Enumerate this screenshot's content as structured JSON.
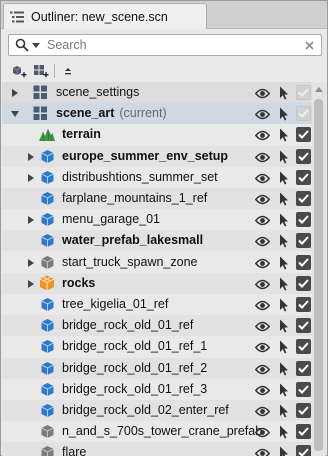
{
  "window": {
    "tab_title": "Outliner: new_scene.scn",
    "tab_icon": "outliner-list-icon"
  },
  "search": {
    "placeholder": "Search",
    "value": ""
  },
  "toolbar": {
    "buttons": [
      "add-object-icon",
      "add-layer-icon",
      "collapse-all-icon"
    ]
  },
  "rows": [
    {
      "label": "scene_settings",
      "suffix": "",
      "bold": false,
      "arrow": "right",
      "icon": "layer-grid-icon",
      "indent": 0,
      "visible": true,
      "enabled": false
    },
    {
      "label": "scene_art",
      "suffix": "(current)",
      "bold": true,
      "arrow": "down",
      "icon": "layer-grid-icon",
      "indent": 0,
      "visible": true,
      "enabled": false
    },
    {
      "label": "terrain",
      "suffix": "",
      "bold": true,
      "arrow": "",
      "icon": "terrain-icon",
      "indent": 1,
      "visible": true,
      "enabled": true
    },
    {
      "label": "europe_summer_env_setup",
      "suffix": "",
      "bold": true,
      "arrow": "right",
      "icon": "blue-cube-icon",
      "indent": 1,
      "visible": true,
      "enabled": true
    },
    {
      "label": "distribushtions_summer_set",
      "suffix": "",
      "bold": false,
      "arrow": "right",
      "icon": "blue-cube-icon",
      "indent": 1,
      "visible": true,
      "enabled": true
    },
    {
      "label": "farplane_mountains_1_ref",
      "suffix": "",
      "bold": false,
      "arrow": "",
      "icon": "blue-cube-icon",
      "indent": 1,
      "visible": true,
      "enabled": true
    },
    {
      "label": "menu_garage_01",
      "suffix": "",
      "bold": false,
      "arrow": "right",
      "icon": "blue-cube-icon",
      "indent": 1,
      "visible": true,
      "enabled": true
    },
    {
      "label": "water_prefab_lakesmall",
      "suffix": "",
      "bold": true,
      "arrow": "",
      "icon": "blue-cube-icon",
      "indent": 1,
      "visible": true,
      "enabled": true
    },
    {
      "label": "start_truck_spawn_zone",
      "suffix": "",
      "bold": false,
      "arrow": "right",
      "icon": "gray-cube-icon",
      "indent": 1,
      "visible": true,
      "enabled": true
    },
    {
      "label": "rocks",
      "suffix": "",
      "bold": true,
      "arrow": "right",
      "icon": "orange-group-icon",
      "indent": 1,
      "visible": true,
      "enabled": true
    },
    {
      "label": "tree_kigelia_01_ref",
      "suffix": "",
      "bold": false,
      "arrow": "",
      "icon": "blue-cube-icon",
      "indent": 1,
      "visible": true,
      "enabled": true
    },
    {
      "label": "bridge_rock_old_01_ref",
      "suffix": "",
      "bold": false,
      "arrow": "",
      "icon": "blue-cube-icon",
      "indent": 1,
      "visible": true,
      "enabled": true
    },
    {
      "label": "bridge_rock_old_01_ref_1",
      "suffix": "",
      "bold": false,
      "arrow": "",
      "icon": "blue-cube-icon",
      "indent": 1,
      "visible": true,
      "enabled": true
    },
    {
      "label": "bridge_rock_old_01_ref_2",
      "suffix": "",
      "bold": false,
      "arrow": "",
      "icon": "blue-cube-icon",
      "indent": 1,
      "visible": true,
      "enabled": true
    },
    {
      "label": "bridge_rock_old_01_ref_3",
      "suffix": "",
      "bold": false,
      "arrow": "",
      "icon": "blue-cube-icon",
      "indent": 1,
      "visible": true,
      "enabled": true
    },
    {
      "label": "bridge_rock_old_02_enter_ref",
      "suffix": "",
      "bold": false,
      "arrow": "",
      "icon": "blue-cube-icon",
      "indent": 1,
      "visible": true,
      "enabled": true
    },
    {
      "label": "n_and_s_700s_tower_crane_prefab",
      "suffix": "",
      "bold": false,
      "arrow": "",
      "icon": "gray-cube-icon",
      "indent": 1,
      "visible": true,
      "enabled": true
    },
    {
      "label": "flare",
      "suffix": "",
      "bold": false,
      "arrow": "",
      "icon": "gray-cube-icon",
      "indent": 1,
      "visible": true,
      "enabled": true
    }
  ],
  "colors": {
    "selected_row": "#cfd9e4",
    "layer_icon": "#4a5a70",
    "blue_cube": "#2f79c8",
    "orange_group": "#e8962a",
    "terrain_green": "#3f9a3f",
    "checkbox": "#4a4a4a"
  }
}
